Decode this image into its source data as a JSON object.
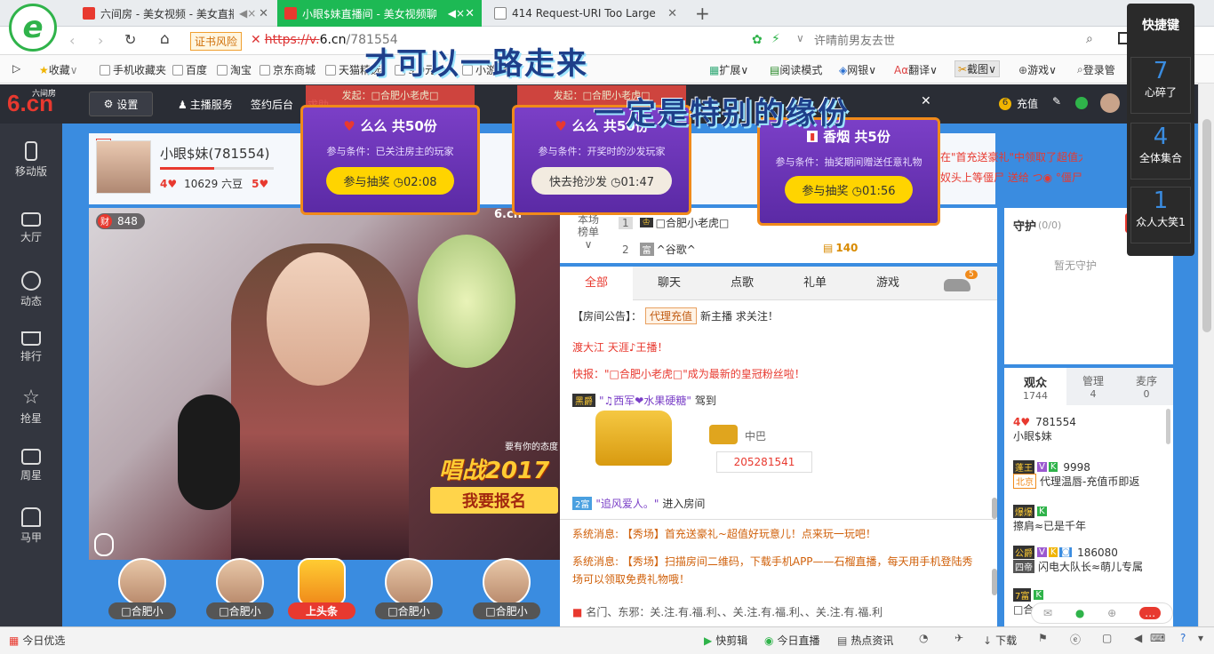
{
  "browser": {
    "tabs": [
      {
        "label": "六间房 - 美女视频 - 美女直播"
      },
      {
        "label": "小眼$妹直播间 - 美女视频聊"
      },
      {
        "label": "414 Request-URI Too Large"
      }
    ],
    "new_tab": "+",
    "url_warning": "证书风险",
    "url_scheme": "https://v.",
    "url_domain": "6.cn",
    "url_path": "/781554",
    "search_placeholder": "许晴前男友去世",
    "bookmarks": [
      "收藏",
      "手机收藏夹",
      "百度",
      "淘宝",
      "京东商城",
      "天猫精选",
      "9.9元",
      "小游戏"
    ],
    "toolbar_right": [
      "扩展",
      "阅读模式",
      "网银",
      "翻译",
      "截图",
      "游戏",
      "登录管"
    ]
  },
  "overlay_text": {
    "line1": "才可以一路走来",
    "line2": "一定是特别的缘份"
  },
  "site": {
    "logo": "6.cn",
    "logo_small": "六间房",
    "settings": "设置",
    "nav": [
      "主播服务",
      "签约后台",
      "求助"
    ],
    "recharge": "充值",
    "sidebar": [
      {
        "label": "移动版",
        "icon": "phone-icon"
      },
      {
        "label": "大厅",
        "icon": "tv-icon"
      },
      {
        "label": "动态",
        "icon": "compass-icon"
      },
      {
        "label": "排行",
        "icon": "crown-icon"
      },
      {
        "label": "抢星",
        "icon": "star-icon"
      },
      {
        "label": "周星",
        "icon": "gift-box-icon"
      },
      {
        "label": "马甲",
        "icon": "shirt-icon"
      }
    ]
  },
  "host": {
    "tag": "聊",
    "name": "小眼$妹(781554)",
    "level_left": "4",
    "beans": "10629 六豆",
    "level_right": "5"
  },
  "video": {
    "wealth_badge": "财",
    "wealth_count": "848",
    "banner_top": "要有你的态度",
    "banner_mid": "唱战2017",
    "banner_btn": "我要报名"
  },
  "lotteries": [
    {
      "source": "发起：□合肥小老虎□",
      "title": "么么 共50份",
      "cond": "参与条件：已关注房主的玩家",
      "button": "参与抽奖",
      "time": "02:08"
    },
    {
      "source": "发起：□合肥小老虎□",
      "title": "么么 共50份",
      "cond": "参与条件：开奖时的沙发玩家",
      "button": "快去抢沙发",
      "time": "01:47"
    },
    {
      "source": "发起：□合肥小老虎□",
      "title": "香烟 共5份",
      "cond": "参与条件：抽奖期间赠送任意礼物",
      "button": "参与抽奖",
      "time": "01:56"
    }
  ],
  "marquee": {
    "line1": "在\"首充送豪礼\"中领取了超值大礼包",
    "line2": "奴头上等僵尸 送给 つ◉ °僵尸 1个摩天"
  },
  "gifts": [
    {
      "label": "□合肥小"
    },
    {
      "label": "□合肥小"
    },
    {
      "label": "上头条"
    },
    {
      "label": "□合肥小"
    },
    {
      "label": "□合肥小"
    }
  ],
  "rank": {
    "label1": "本场",
    "label2": "榜单",
    "rows": [
      {
        "rank": "1",
        "name": "□合肥小老虎□",
        "value": ""
      },
      {
        "rank": "2",
        "name": "^谷歌^",
        "value": "140"
      }
    ]
  },
  "chat_tabs": [
    {
      "label": "全部"
    },
    {
      "label": "聊天"
    },
    {
      "label": "点歌"
    },
    {
      "label": "礼单"
    },
    {
      "label": "游戏"
    }
  ],
  "car_badge": "5",
  "chat": {
    "announce_label": "【房间公告】：",
    "announce_tag": "代理充值",
    "announce_text": "新主播 求关注！",
    "msg1": "渡大江 天涯♪王播！",
    "msg2": "快报：\"□合肥小老虎□\"成为最新的皇冠粉丝啦！",
    "car_user": "\"♫西军❤水果硬糖\"",
    "car_action": "驾到",
    "car_name": "中巴",
    "car_id": "205281541",
    "enter_user": "\"追风爱人。\"",
    "enter_action": "进入房间",
    "sys1": "系统消息: 【秀场】首充送豪礼~超值好玩意儿！点来玩一玩吧！",
    "sys2": "系统消息: 【秀场】扫描房间二维码，下载手机APP——石榴直播，每天用手机登陆秀场可以领取免费礼物哦！",
    "sys3": "名门、东邪：关.注.有.福.利、、关.注.有.福.利、、关.注.有.福.利"
  },
  "guard": {
    "title": "守护",
    "count": "(0/0)",
    "empty": "暂无守护"
  },
  "audience_tabs": [
    {
      "label": "观众",
      "count": "1744"
    },
    {
      "label": "管理",
      "count": "4"
    },
    {
      "label": "麦序",
      "count": "0"
    }
  ],
  "audience": [
    {
      "badge": "4",
      "id": "781554",
      "name": "小眼$妹"
    },
    {
      "badge": "蓬王",
      "id": "9998",
      "name": "代理温唇-充值币即返",
      "tag": "北京"
    },
    {
      "badge": "爆爆",
      "id": "",
      "name": "擦肩≈已是千年"
    },
    {
      "badge": "公爵",
      "id": "186080",
      "name": "闪电大队长≈萌儿专属",
      "tag": "四帝"
    },
    {
      "badge": "7富",
      "id": "",
      "name": "□合"
    }
  ],
  "hotkeys": {
    "title": "快捷键",
    "items": [
      {
        "num": "7",
        "label": "心碎了"
      },
      {
        "num": "4",
        "label": "全体集合"
      },
      {
        "num": "1",
        "label": "众人大笑1"
      }
    ]
  },
  "statusbar": {
    "left": "今日优选",
    "items": [
      "快剪辑",
      "今日直播",
      "热点资讯",
      "下载"
    ]
  }
}
